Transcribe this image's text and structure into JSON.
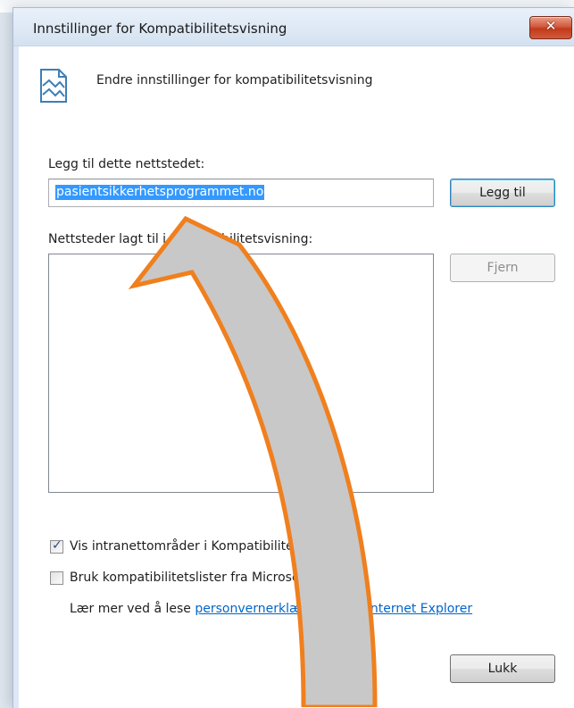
{
  "window": {
    "title": "Innstillinger for Kompatibilitetsvisning",
    "close_label": "✕"
  },
  "header": {
    "text": "Endre innstillinger for kompatibilitetsvisning",
    "icon": "compatibility-view-icon"
  },
  "add_site": {
    "label": "Legg til dette nettstedet:",
    "value": "pasientsikkerhetsprogrammet.no",
    "button": "Legg til"
  },
  "site_list": {
    "label": "Nettsteder lagt til i Kompatibilitetsvisning:",
    "items": [],
    "remove_button": "Fjern"
  },
  "options": {
    "intranet": {
      "label": "Vis intranettområder i Kompatibilitetsvisning",
      "checked": true
    },
    "ms_lists": {
      "label": "Bruk kompatibilitetslister fra Microsoft",
      "checked": false
    }
  },
  "privacy": {
    "prefix": "Lær mer ved å lese ",
    "link_text": "personvernerklæringen for Internet Explorer"
  },
  "footer": {
    "close_button": "Lukk"
  },
  "colors": {
    "selection": "#3399ff",
    "link": "#0066cc",
    "arrow_fill": "#c8c8c8",
    "arrow_stroke": "#f07f1e",
    "close_button": "#c23a1c"
  }
}
